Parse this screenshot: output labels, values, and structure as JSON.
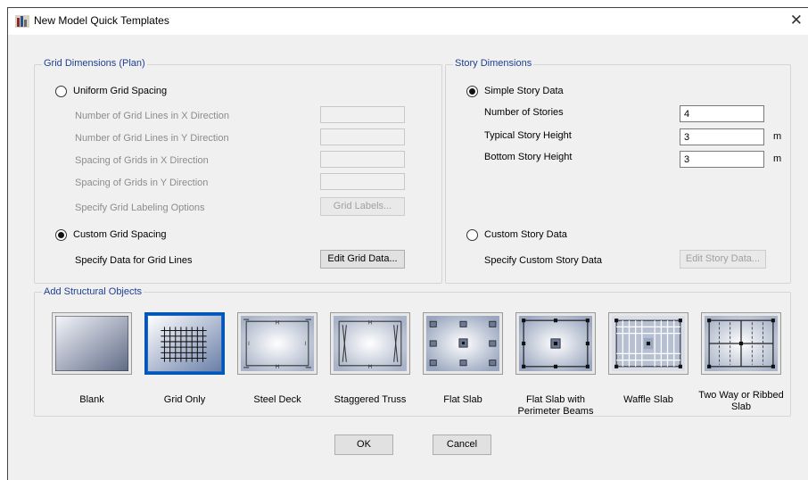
{
  "window": {
    "title": "New Model Quick Templates",
    "close_glyph": "✕"
  },
  "grid_dimensions": {
    "title": "Grid Dimensions (Plan)",
    "uniform_label": "Uniform Grid Spacing",
    "uniform_checked": false,
    "lines_x_label": "Number of Grid Lines in X Direction",
    "lines_y_label": "Number of Grid Lines in Y Direction",
    "spacing_x_label": "Spacing of Grids in X Direction",
    "spacing_y_label": "Spacing of Grids in Y Direction",
    "labeling_label": "Specify Grid Labeling Options",
    "grid_labels_button": "Grid Labels...",
    "custom_label": "Custom Grid Spacing",
    "custom_checked": true,
    "specify_data_label": "Specify Data for Grid Lines",
    "edit_grid_button": "Edit Grid Data..."
  },
  "story_dimensions": {
    "title": "Story Dimensions",
    "simple_label": "Simple Story Data",
    "simple_checked": true,
    "num_stories_label": "Number of Stories",
    "num_stories_value": "4",
    "typical_height_label": "Typical Story Height",
    "typical_height_value": "3",
    "typical_height_unit": "m",
    "bottom_height_label": "Bottom Story Height",
    "bottom_height_value": "3",
    "bottom_height_unit": "m",
    "custom_label": "Custom Story Data",
    "custom_checked": false,
    "specify_custom_label": "Specify Custom Story Data",
    "edit_story_button": "Edit Story Data..."
  },
  "structural_objects": {
    "title": "Add Structural Objects",
    "templates": [
      {
        "label": "Blank",
        "icon": "blank-template-icon",
        "selected": false
      },
      {
        "label": "Grid Only",
        "icon": "grid-only-template-icon",
        "selected": true
      },
      {
        "label": "Steel Deck",
        "icon": "steel-deck-template-icon",
        "selected": false
      },
      {
        "label": "Staggered Truss",
        "icon": "staggered-truss-template-icon",
        "selected": false
      },
      {
        "label": "Flat Slab",
        "icon": "flat-slab-template-icon",
        "selected": false
      },
      {
        "label": "Flat Slab with Perimeter Beams",
        "icon": "flat-slab-perimeter-template-icon",
        "selected": false
      },
      {
        "label": "Waffle Slab",
        "icon": "waffle-slab-template-icon",
        "selected": false
      },
      {
        "label": "Two Way or Ribbed Slab",
        "icon": "ribbed-slab-template-icon",
        "selected": false
      }
    ]
  },
  "buttons": {
    "ok": "OK",
    "cancel": "Cancel"
  }
}
